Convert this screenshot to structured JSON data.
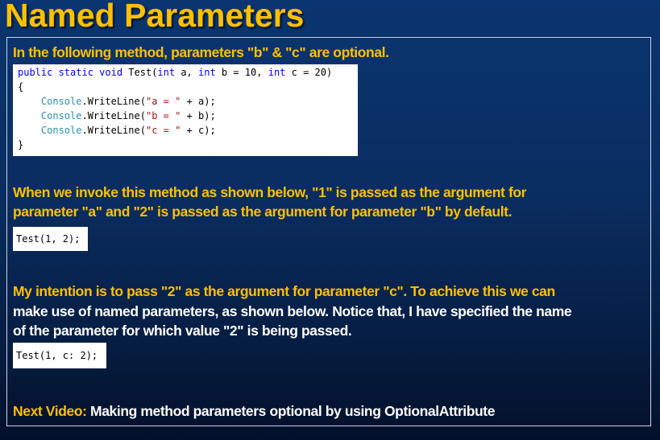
{
  "slide": {
    "title": "Named Parameters"
  },
  "paragraphs": {
    "intro": "In the following method, parameters \"b\" & \"c\" are optional.",
    "invoke_line1": "When we invoke this method as shown below, \"1\" is passed as the argument for",
    "invoke_line2": "parameter \"a\" and \"2\" is passed as the argument for parameter \"b\" by default.",
    "intention_line1": "My intention is to pass \"2\" as the argument for parameter \"c\". To achieve this we can",
    "intention_line2": "make use of named parameters, as shown below. Notice that, I have specified the name",
    "intention_line3": "of the parameter for which value \"2\" is being passed.",
    "next_label": "Next Video:",
    "next_text": " Making method parameters optional by using OptionalAttribute"
  },
  "code_method": {
    "sig_kw": "public static void",
    "sig_name": " Test(",
    "p1_type": "int",
    "p1_rest": " a, ",
    "p2_type": "int",
    "p2_rest": " b = 10, ",
    "p3_type": "int",
    "p3_rest": " c = 20)",
    "open_brace": "{",
    "lines": [
      {
        "indent": "    ",
        "cls": "Console",
        "method": ".WriteLine(",
        "str": "\"a = \"",
        "rest": " + a);"
      },
      {
        "indent": "    ",
        "cls": "Console",
        "method": ".WriteLine(",
        "str": "\"b = \"",
        "rest": " + b);"
      },
      {
        "indent": "    ",
        "cls": "Console",
        "method": ".WriteLine(",
        "str": "\"c = \"",
        "rest": " + c);"
      }
    ],
    "close_brace": "}"
  },
  "code_call1": "Test(1, 2);",
  "code_call2": "Test(1, c: 2);",
  "colors": {
    "title": "#ffc000",
    "keyword": "#0000ff",
    "type": "#2b91af",
    "string": "#a31515"
  }
}
